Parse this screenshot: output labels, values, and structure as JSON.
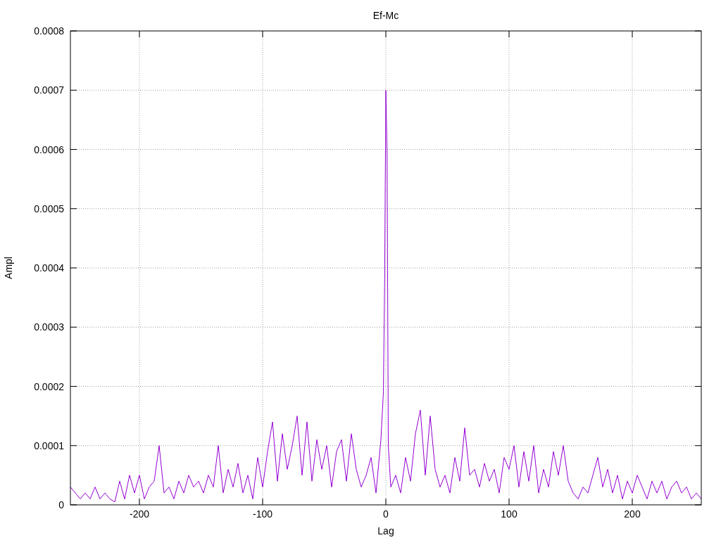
{
  "chart": {
    "chart_data": {
      "type": "line",
      "grid": true,
      "title": "Ef-Mc",
      "xlabel": "Lag",
      "ylabel": "Ampl",
      "xlim": [
        -256,
        256
      ],
      "ylim": [
        0,
        0.0008
      ],
      "xticks": [
        -200,
        -100,
        0,
        100,
        200
      ],
      "yticks": [
        {
          "value": 0,
          "label": "0"
        },
        {
          "value": 0.0001,
          "label": "0.0001"
        },
        {
          "value": 0.0002,
          "label": "0.0002"
        },
        {
          "value": 0.0003,
          "label": "0.0003"
        },
        {
          "value": 0.0004,
          "label": "0.0004"
        },
        {
          "value": 0.0005,
          "label": "0.0005"
        },
        {
          "value": 0.0006,
          "label": "0.0006"
        },
        {
          "value": 0.0007,
          "label": "0.0007"
        },
        {
          "value": 0.0008,
          "label": "0.0008"
        }
      ],
      "x": [
        -256,
        -252,
        -248,
        -244,
        -240,
        -236,
        -232,
        -228,
        -224,
        -220,
        -216,
        -212,
        -208,
        -204,
        -200,
        -196,
        -192,
        -188,
        -184,
        -180,
        -176,
        -172,
        -168,
        -164,
        -160,
        -156,
        -152,
        -148,
        -144,
        -140,
        -136,
        -132,
        -128,
        -124,
        -120,
        -116,
        -112,
        -108,
        -104,
        -100,
        -96,
        -92,
        -88,
        -84,
        -80,
        -76,
        -72,
        -68,
        -64,
        -60,
        -56,
        -52,
        -48,
        -44,
        -40,
        -36,
        -32,
        -28,
        -24,
        -20,
        -16,
        -12,
        -8,
        -4,
        -2,
        -1,
        0,
        1,
        2,
        4,
        8,
        12,
        16,
        20,
        24,
        28,
        32,
        36,
        40,
        44,
        48,
        52,
        56,
        60,
        64,
        68,
        72,
        76,
        80,
        84,
        88,
        92,
        96,
        100,
        104,
        108,
        112,
        116,
        120,
        124,
        128,
        132,
        136,
        140,
        144,
        148,
        152,
        156,
        160,
        164,
        168,
        172,
        176,
        180,
        184,
        188,
        192,
        196,
        200,
        204,
        208,
        212,
        216,
        220,
        224,
        228,
        232,
        236,
        240,
        244,
        248,
        252,
        256
      ],
      "series": [
        {
          "color": "#9400d3",
          "values": [
            3e-05,
            2e-05,
            1e-05,
            2e-05,
            1e-05,
            3e-05,
            1e-05,
            2e-05,
            1e-05,
            5e-06,
            4e-05,
            1e-05,
            5e-05,
            2e-05,
            5e-05,
            1e-05,
            3e-05,
            4e-05,
            0.0001,
            2e-05,
            3e-05,
            1e-05,
            4e-05,
            2e-05,
            5e-05,
            3e-05,
            4e-05,
            2e-05,
            5e-05,
            3e-05,
            0.0001,
            2e-05,
            6e-05,
            3e-05,
            7e-05,
            2e-05,
            5e-05,
            1e-05,
            8e-05,
            3e-05,
            9e-05,
            0.00014,
            4e-05,
            0.00012,
            6e-05,
            0.0001,
            0.00015,
            5e-05,
            0.00014,
            4e-05,
            0.00011,
            6e-05,
            0.0001,
            3e-05,
            9e-05,
            0.00011,
            4e-05,
            0.00012,
            6e-05,
            3e-05,
            5e-05,
            8e-05,
            2e-05,
            0.00011,
            0.00019,
            0.00038,
            0.0007,
            0.00059,
            0.0001,
            3e-05,
            5e-05,
            2e-05,
            8e-05,
            4e-05,
            0.00012,
            0.00016,
            5e-05,
            0.00015,
            6e-05,
            3e-05,
            5e-05,
            2e-05,
            8e-05,
            4e-05,
            0.00013,
            5e-05,
            6e-05,
            3e-05,
            7e-05,
            4e-05,
            6e-05,
            2e-05,
            8e-05,
            6e-05,
            0.0001,
            3e-05,
            9e-05,
            4e-05,
            0.0001,
            2e-05,
            6e-05,
            3e-05,
            9e-05,
            5e-05,
            0.0001,
            4e-05,
            2e-05,
            1e-05,
            3e-05,
            2e-05,
            5e-05,
            8e-05,
            3e-05,
            6e-05,
            2e-05,
            5e-05,
            1e-05,
            4e-05,
            2e-05,
            5e-05,
            3e-05,
            1e-05,
            4e-05,
            2e-05,
            4e-05,
            1e-05,
            3e-05,
            4e-05,
            2e-05,
            3e-05,
            1e-05,
            2e-05,
            1e-05
          ]
        }
      ]
    }
  }
}
